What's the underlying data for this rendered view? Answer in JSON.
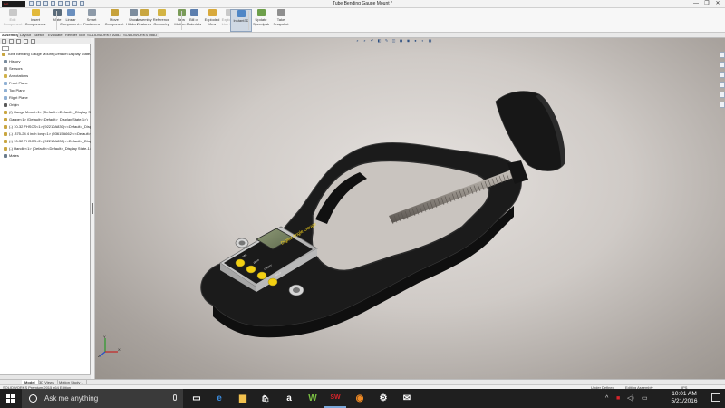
{
  "window": {
    "title": "Tube Bending Gauge Mount *",
    "brand": "DS SOLIDWORKS",
    "controls": [
      "—",
      "❐",
      "✕"
    ]
  },
  "ribbon": {
    "buttons": [
      {
        "label": "Edit Component",
        "icon": "edit-component-icon",
        "color": "#8ab0d8",
        "disabled": true
      },
      {
        "label": "Insert Components",
        "icon": "insert-components-icon",
        "color": "#e2b93b",
        "disabled": false
      },
      {
        "label": "Mate",
        "icon": "mate-icon",
        "color": "#5a6b7a",
        "disabled": false
      },
      {
        "label": "Linear Component...",
        "icon": "linear-pattern-icon",
        "color": "#6a8fbe",
        "disabled": false
      },
      {
        "label": "Smart Fasteners",
        "icon": "smart-fasteners-icon",
        "color": "#8d9aa8",
        "disabled": false
      },
      {
        "label": "Move Component",
        "icon": "move-component-icon",
        "color": "#c7a23c",
        "disabled": false
      },
      {
        "label": "Show Hidden...",
        "icon": "show-hidden-icon",
        "color": "#7d8d9e",
        "disabled": false
      },
      {
        "label": "Assembly Features",
        "icon": "assembly-features-icon",
        "color": "#c9a640",
        "disabled": false
      },
      {
        "label": "Reference Geometry",
        "icon": "reference-geometry-icon",
        "color": "#d3b444",
        "disabled": false
      },
      {
        "label": "New Motion...",
        "icon": "new-motion-study-icon",
        "color": "#7a9b59",
        "disabled": false
      },
      {
        "label": "Bill of Materials",
        "icon": "bill-of-materials-icon",
        "color": "#5d7fae",
        "disabled": false
      },
      {
        "label": "Exploded View",
        "icon": "exploded-view-icon",
        "color": "#d8a93c",
        "disabled": false
      },
      {
        "label": "Exploded Line Sk...",
        "icon": "explode-line-sketch-icon",
        "color": "#9aa7b5",
        "disabled": true
      },
      {
        "label": "Instant3D",
        "icon": "instant3d-icon",
        "color": "#4f86c6",
        "disabled": false,
        "selected": true
      },
      {
        "label": "Update Speedpak",
        "icon": "speedpak-icon",
        "color": "#6d9f4b",
        "disabled": false
      },
      {
        "label": "Take Snapshot",
        "icon": "snapshot-icon",
        "color": "#8f8f8f",
        "disabled": false
      }
    ]
  },
  "command_tabs": [
    "Assembly",
    "Layout",
    "Sketch",
    "Evaluate",
    "Render Tools",
    "SOLIDWORKS Add-Ins",
    "SOLIDWORKS MBD"
  ],
  "feature_tree": {
    "items": [
      {
        "label": "Tube Bending Gauge Mount  (Default<Display State-1>)",
        "indent": 0,
        "color": "#c9a640"
      },
      {
        "label": "History",
        "indent": 1,
        "color": "#7a8c9e"
      },
      {
        "label": "Sensors",
        "indent": 1,
        "color": "#9a9a9a"
      },
      {
        "label": "Annotations",
        "indent": 1,
        "color": "#d1b24a"
      },
      {
        "label": "Front Plane",
        "indent": 1,
        "color": "#8fb0d4"
      },
      {
        "label": "Top Plane",
        "indent": 1,
        "color": "#8fb0d4"
      },
      {
        "label": "Right Plane",
        "indent": 1,
        "color": "#8fb0d4"
      },
      {
        "label": "Origin",
        "indent": 1,
        "color": "#5a5a5a"
      },
      {
        "label": "(f) Gauge Mount<1> (Default<<Default>_Display State",
        "indent": 1,
        "color": "#c9a640"
      },
      {
        "label": "Gauge<1> (Default<<Default>_Display State-1>)",
        "indent": 1,
        "color": "#c9a640"
      },
      {
        "label": "(-) 10-32 FHSCS<1> (92210A830)<<Default>_Displ",
        "indent": 1,
        "color": "#c9a640"
      },
      {
        "label": "(-) .375-24 4 inch long<1> (93615A662)<<Default>_Disp",
        "indent": 1,
        "color": "#c9a640"
      },
      {
        "label": "(-) 10-32 FHSCS<2> (92210A830)<<Default>_Displ",
        "indent": 1,
        "color": "#c9a640"
      },
      {
        "label": "(-) Handle<1> (Default<<Default>_Display State-1>)",
        "indent": 1,
        "color": "#c9a640"
      },
      {
        "label": "Mates",
        "indent": 1,
        "color": "#6a7b8c"
      }
    ]
  },
  "model_tabs": [
    "Model",
    "3D Views",
    "Motion Study 1"
  ],
  "status": {
    "left": "SOLIDWORKS Premium 2015 x64 Edition",
    "state": "Under Defined",
    "mode": "Editing Assembly",
    "units": "IPS"
  },
  "gauge": {
    "title": "Digital Angle Gauge",
    "buttons": [
      "ABS",
      "ZERO",
      "ON/OFF",
      "HOLD"
    ]
  },
  "triad": {
    "x": "X",
    "y": "Y",
    "z": "Z"
  },
  "taskbar": {
    "search_placeholder": "Ask me anything",
    "apps": [
      {
        "name": "task-view-icon",
        "glyph": "▭",
        "color": "#ffffff"
      },
      {
        "name": "edge-icon",
        "glyph": "e",
        "color": "#3b8de0"
      },
      {
        "name": "file-explorer-icon",
        "glyph": "▆",
        "color": "#f2c14e"
      },
      {
        "name": "store-icon",
        "glyph": "🛍",
        "color": "#ffffff"
      },
      {
        "name": "amazon-icon",
        "glyph": "a",
        "color": "#ffffff"
      },
      {
        "name": "w-app-icon",
        "glyph": "W",
        "color": "#7bc043"
      },
      {
        "name": "solidworks-icon",
        "glyph": "SW",
        "color": "#d9242b"
      },
      {
        "name": "firefox-icon",
        "glyph": "◉",
        "color": "#f08a24"
      },
      {
        "name": "settings-icon",
        "glyph": "⚙",
        "color": "#ffffff"
      },
      {
        "name": "mail-icon",
        "glyph": "✉",
        "color": "#ffffff"
      }
    ],
    "time": "10:01 AM",
    "date": "5/21/2016"
  }
}
